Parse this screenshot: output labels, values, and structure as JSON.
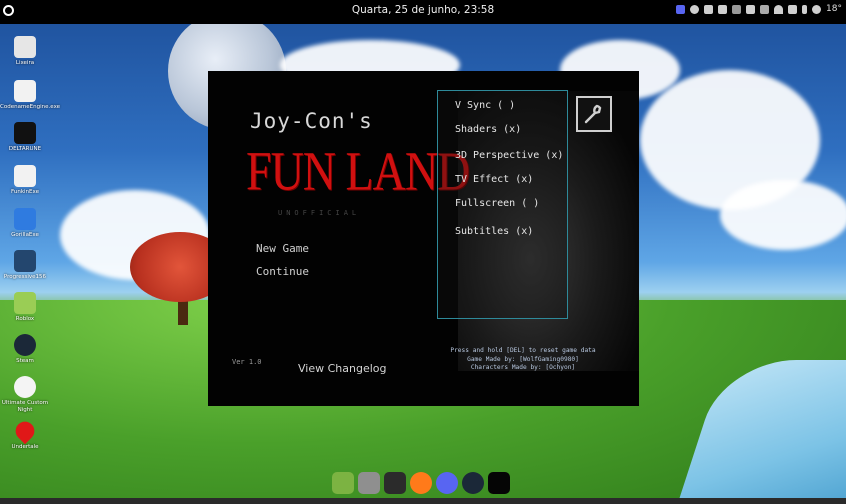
{
  "topbar": {
    "datetime": "Quarta, 25 de junho, 23:58",
    "temperature": "18°"
  },
  "desktop_icons": [
    {
      "label": "Lixeira",
      "icon": "trash-icon",
      "color": "#e6e6e6"
    },
    {
      "label": "CodenameEngine.exe",
      "icon": "file-icon",
      "color": "#f2f2f2"
    },
    {
      "label": "DELTARUNE",
      "icon": "deltarune-icon",
      "color": "#111111"
    },
    {
      "label": "FunkinExe",
      "icon": "file-icon",
      "color": "#f2f2f2"
    },
    {
      "label": "GorillaExe",
      "icon": "gorilla-icon",
      "color": "#2f7be0"
    },
    {
      "label": "Progressive156",
      "icon": "app-icon",
      "color": "#23466e"
    },
    {
      "label": "Roblox",
      "icon": "roblox-icon",
      "color": "#9acd55"
    },
    {
      "label": "Steam",
      "icon": "steam-icon",
      "color": "#1b2838"
    },
    {
      "label": "Ultimate Custom Night",
      "icon": "panda-icon",
      "color": "#f4f4f4"
    },
    {
      "label": "Undertale",
      "icon": "heart-icon",
      "color": "#e01818"
    }
  ],
  "dock": [
    {
      "name": "dock-minecraft",
      "icon": "minecraft-icon",
      "color": "#7cb342"
    },
    {
      "name": "dock-files",
      "icon": "folder-icon",
      "color": "#8f8f8f"
    },
    {
      "name": "dock-terminal",
      "icon": "terminal-icon",
      "color": "#2b2b2b"
    },
    {
      "name": "dock-firefox",
      "icon": "firefox-icon",
      "color": "#ff7a1a"
    },
    {
      "name": "dock-discord",
      "icon": "discord-icon",
      "color": "#5865f2"
    },
    {
      "name": "dock-steam",
      "icon": "steam-icon",
      "color": "#1b2838"
    },
    {
      "name": "dock-game",
      "icon": "game-icon",
      "color": "#050505"
    }
  ],
  "game": {
    "title_line1": "Joy-Con's",
    "title_line2": "FUN LAND",
    "title_line3": "UNOFFICIAL",
    "menu": {
      "new_game": "New Game",
      "continue": "Continue"
    },
    "version": "Ver 1.0",
    "changelog": "View Changelog",
    "settings": [
      "V Sync ( )",
      "Shaders (x)",
      "3D Perspective (x)",
      "TV Effect (x)",
      "Fullscreen ( )",
      "Subtitles (x)"
    ],
    "credits": [
      "Press and hold [DEL] to reset game data",
      "Game Made by: [WolfGaming0980]",
      "Characters Made by: [Ochyon]"
    ]
  }
}
